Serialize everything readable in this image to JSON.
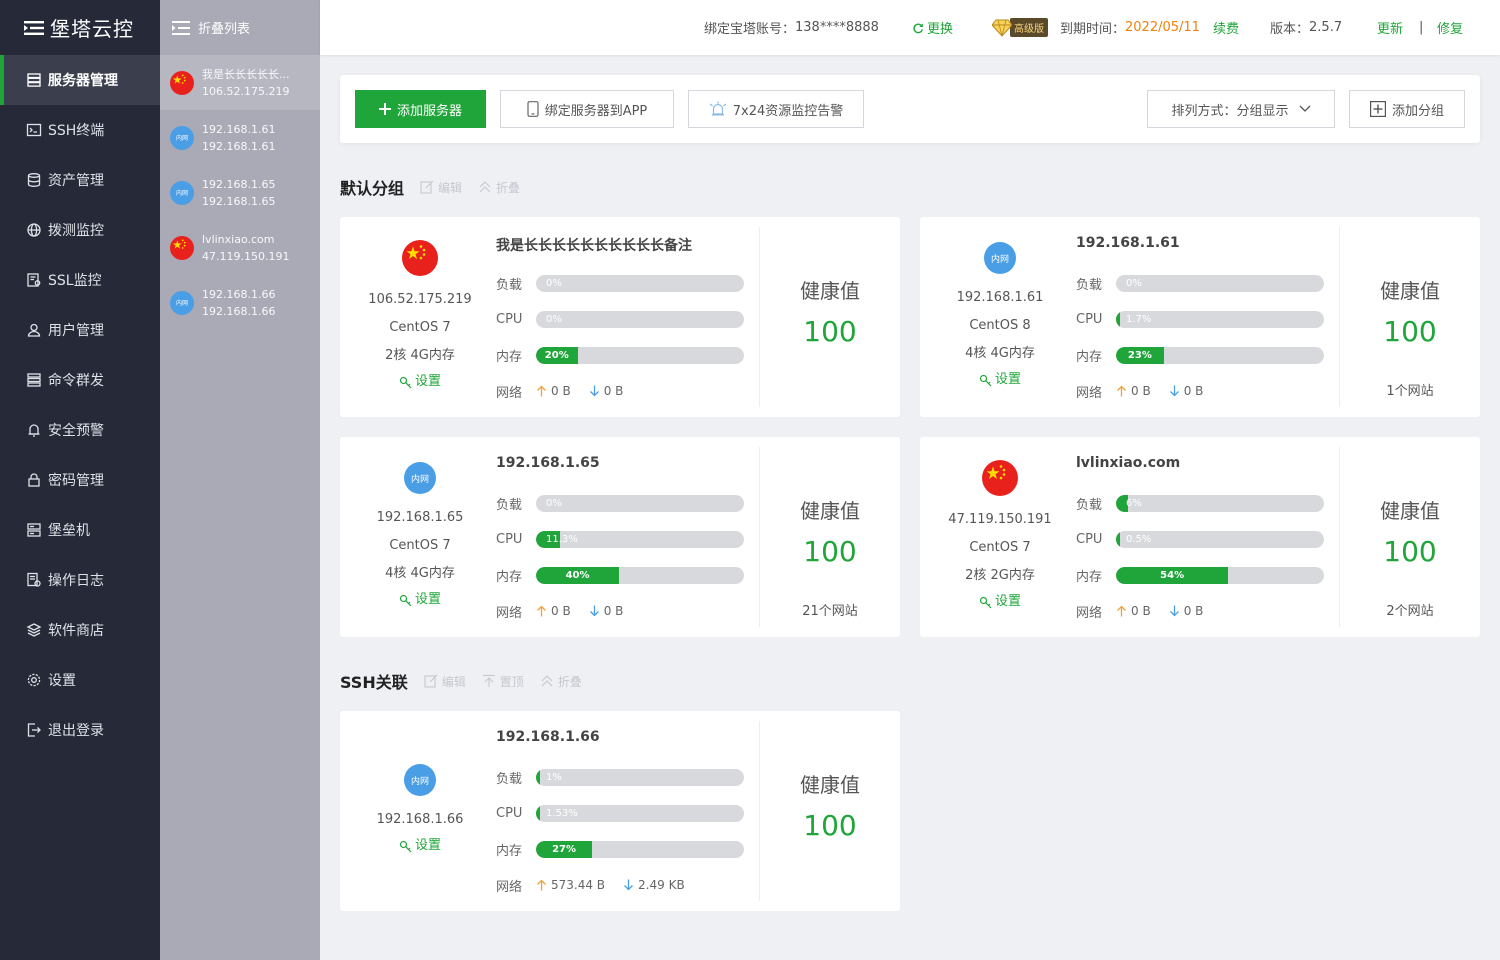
{
  "app": {
    "title": "堡塔云控"
  },
  "sidebar": {
    "items": [
      {
        "label": "服务器管理",
        "icon": "server-icon"
      },
      {
        "label": "SSH终端",
        "icon": "terminal-icon"
      },
      {
        "label": "资产管理",
        "icon": "database-icon"
      },
      {
        "label": "拨测监控",
        "icon": "globe-icon"
      },
      {
        "label": "SSL监控",
        "icon": "certificate-icon"
      },
      {
        "label": "用户管理",
        "icon": "user-icon"
      },
      {
        "label": "命令群发",
        "icon": "stack-icon"
      },
      {
        "label": "安全预警",
        "icon": "bell-icon"
      },
      {
        "label": "密码管理",
        "icon": "lock-icon"
      },
      {
        "label": "堡垒机",
        "icon": "server-rack-icon"
      },
      {
        "label": "操作日志",
        "icon": "log-icon"
      },
      {
        "label": "软件商店",
        "icon": "layers-icon"
      },
      {
        "label": "设置",
        "icon": "gear-icon"
      },
      {
        "label": "退出登录",
        "icon": "logout-icon"
      }
    ]
  },
  "server_list": {
    "header": "折叠列表",
    "items": [
      {
        "name": "我是长长长长长...",
        "ip": "106.52.175.219",
        "flag": "cn"
      },
      {
        "name": "192.168.1.61",
        "ip": "192.168.1.61",
        "flag": "lan"
      },
      {
        "name": "192.168.1.65",
        "ip": "192.168.1.65",
        "flag": "lan"
      },
      {
        "name": "lvlinxiao.com",
        "ip": "47.119.150.191",
        "flag": "cn"
      },
      {
        "name": "192.168.1.66",
        "ip": "192.168.1.66",
        "flag": "lan"
      }
    ]
  },
  "topbar": {
    "account_label": "绑定宝塔账号：",
    "account": "138****8888",
    "change": "更换",
    "edition_badge": "高级版",
    "expire_label": "到期时间：",
    "expire_date": "2022/05/11",
    "renew": "续费",
    "version_label": "版本：",
    "version": "2.5.7",
    "update": "更新",
    "separator": "|",
    "repair": "修复"
  },
  "toolbar": {
    "add_server": "添加服务器",
    "bind_app": "绑定服务器到APP",
    "monitor_alert": "7x24资源监控告警",
    "sort_label": "排列方式：分组显示",
    "add_group": "添加分组"
  },
  "lan_label": "内网",
  "labels": {
    "load": "负载",
    "cpu": "CPU",
    "mem": "内存",
    "net": "网络",
    "settings": "设置",
    "health": "健康值"
  },
  "groups": [
    {
      "title": "默认分组",
      "actions": [
        {
          "label": "编辑",
          "icon": "edit-icon"
        },
        {
          "label": "折叠",
          "icon": "collapse-icon"
        }
      ],
      "cards": [
        {
          "flag": "cn",
          "ip": "106.52.175.219",
          "os": "CentOS 7",
          "spec": "2核 4G内存",
          "name": "我是长长长长长长长长长长备注",
          "load": {
            "text": "0%",
            "value": 0
          },
          "cpu": {
            "text": "0%",
            "value": 0
          },
          "mem": {
            "text": "20%",
            "value": 20
          },
          "up": "0 B",
          "down": "0 B",
          "health": "100",
          "sites": ""
        },
        {
          "flag": "lan",
          "ip": "192.168.1.61",
          "os": "CentOS 8",
          "spec": "4核 4G内存",
          "name": "192.168.1.61",
          "load": {
            "text": "0%",
            "value": 0
          },
          "cpu": {
            "text": "1.7%",
            "value": 1.7
          },
          "mem": {
            "text": "23%",
            "value": 23
          },
          "up": "0 B",
          "down": "0 B",
          "health": "100",
          "sites": "1个网站"
        },
        {
          "flag": "lan",
          "ip": "192.168.1.65",
          "os": "CentOS 7",
          "spec": "4核 4G内存",
          "name": "192.168.1.65",
          "load": {
            "text": "0%",
            "value": 0
          },
          "cpu": {
            "text": "11.3%",
            "value": 11.3
          },
          "mem": {
            "text": "40%",
            "value": 40
          },
          "up": "0 B",
          "down": "0 B",
          "health": "100",
          "sites": "21个网站"
        },
        {
          "flag": "cn",
          "ip": "47.119.150.191",
          "os": "CentOS 7",
          "spec": "2核 2G内存",
          "name": "lvlinxiao.com",
          "load": {
            "text": "6%",
            "value": 6
          },
          "cpu": {
            "text": "0.5%",
            "value": 0.5
          },
          "mem": {
            "text": "54%",
            "value": 54
          },
          "up": "0 B",
          "down": "0 B",
          "health": "100",
          "sites": "2个网站"
        }
      ]
    },
    {
      "title": "SSH关联",
      "actions": [
        {
          "label": "编辑",
          "icon": "edit-icon"
        },
        {
          "label": "置顶",
          "icon": "pin-top-icon"
        },
        {
          "label": "折叠",
          "icon": "collapse-icon"
        }
      ],
      "cards": [
        {
          "flag": "lan",
          "ip": "192.168.1.66",
          "os": "",
          "spec": "",
          "name": "192.168.1.66",
          "load": {
            "text": "1%",
            "value": 1
          },
          "cpu": {
            "text": "1.53%",
            "value": 1.53
          },
          "mem": {
            "text": "27%",
            "value": 27
          },
          "up": "573.44 B",
          "down": "2.49 KB",
          "health": "100",
          "sites": ""
        }
      ]
    }
  ],
  "colors": {
    "accent": "#20a53a",
    "sidebar_bg": "#262a38",
    "list_bg": "#a9aab5",
    "warning": "#f0820a",
    "lan_badge": "#4a9ee6",
    "flag_red": "#e8211d",
    "flag_star": "#ffde00"
  }
}
